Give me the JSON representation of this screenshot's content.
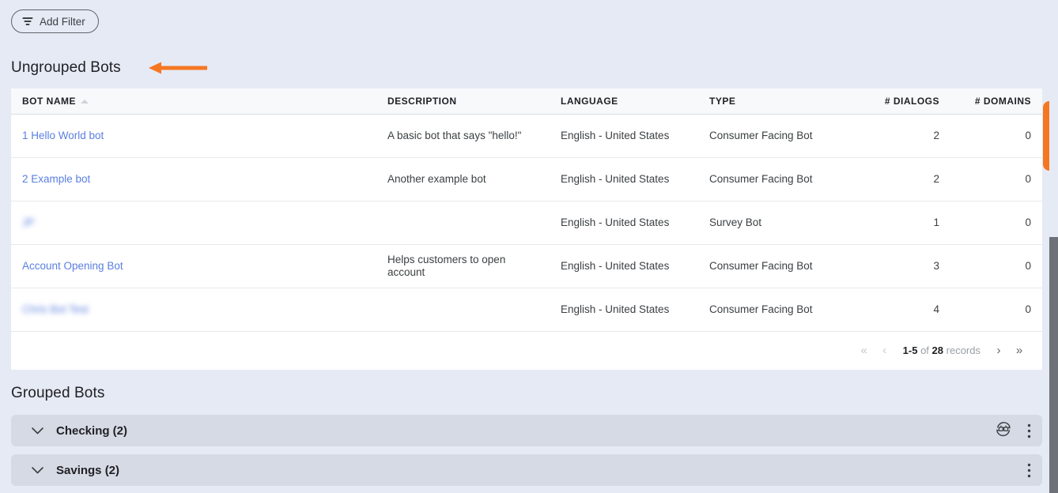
{
  "toolbar": {
    "add_filter_label": "Add Filter",
    "filter_icon": "funnel-icon"
  },
  "annotation": {
    "arrow_color": "#f57722",
    "points_to": "Ungrouped Bots"
  },
  "ungrouped": {
    "title": "Ungrouped Bots",
    "columns": [
      {
        "key": "name",
        "label": "BOT NAME",
        "align": "left",
        "sorted": true
      },
      {
        "key": "desc",
        "label": "DESCRIPTION",
        "align": "left",
        "sorted": false
      },
      {
        "key": "language",
        "label": "LANGUAGE",
        "align": "left",
        "sorted": false
      },
      {
        "key": "type",
        "label": "TYPE",
        "align": "left",
        "sorted": false
      },
      {
        "key": "dialogs",
        "label": "# DIALOGS",
        "align": "right",
        "sorted": false
      },
      {
        "key": "domains",
        "label": "# DOMAINS",
        "align": "right",
        "sorted": false
      }
    ],
    "rows": [
      {
        "name": "1 Hello World bot",
        "redacted": false,
        "desc": "A basic bot that says \"hello!\"",
        "language": "English - United States",
        "type": "Consumer Facing Bot",
        "dialogs": "2",
        "domains": "0"
      },
      {
        "name": "2 Example bot",
        "redacted": false,
        "desc": "Another example bot",
        "language": "English - United States",
        "type": "Consumer Facing Bot",
        "dialogs": "2",
        "domains": "0"
      },
      {
        "name": "JP",
        "redacted": true,
        "desc": "",
        "language": "English - United States",
        "type": "Survey Bot",
        "dialogs": "1",
        "domains": "0"
      },
      {
        "name": "Account Opening Bot",
        "redacted": false,
        "desc": "Helps customers to open account",
        "language": "English - United States",
        "type": "Consumer Facing Bot",
        "dialogs": "3",
        "domains": "0"
      },
      {
        "name": "Chris Bot Test",
        "redacted": true,
        "desc": "",
        "language": "English - United States",
        "type": "Consumer Facing Bot",
        "dialogs": "4",
        "domains": "0"
      }
    ],
    "pagination": {
      "first_label": "«",
      "prev_label": "‹",
      "next_label": "›",
      "last_label": "»",
      "range": "1-5",
      "of_label": "of",
      "total": "28",
      "records_label": "records"
    }
  },
  "grouped": {
    "title": "Grouped Bots",
    "groups": [
      {
        "label": "Checking (2)",
        "expand_icon": "chevron-down-icon",
        "has_swap_bots": true,
        "swap_icon": "swap-bots-icon",
        "menu_icon": "kebab-menu-icon"
      },
      {
        "label": "Savings (2)",
        "expand_icon": "chevron-down-icon",
        "has_swap_bots": false,
        "swap_icon": "",
        "menu_icon": "kebab-menu-icon"
      }
    ]
  },
  "side_tab": {
    "icon": "vertical-dots-icon",
    "color": "#f57722"
  },
  "colors": {
    "page_background": "#e6eaf5",
    "accent_orange": "#f57722",
    "link_blue": "#5a7fe0",
    "group_row": "#d6dae5",
    "table_header": "#f8f9fa"
  }
}
